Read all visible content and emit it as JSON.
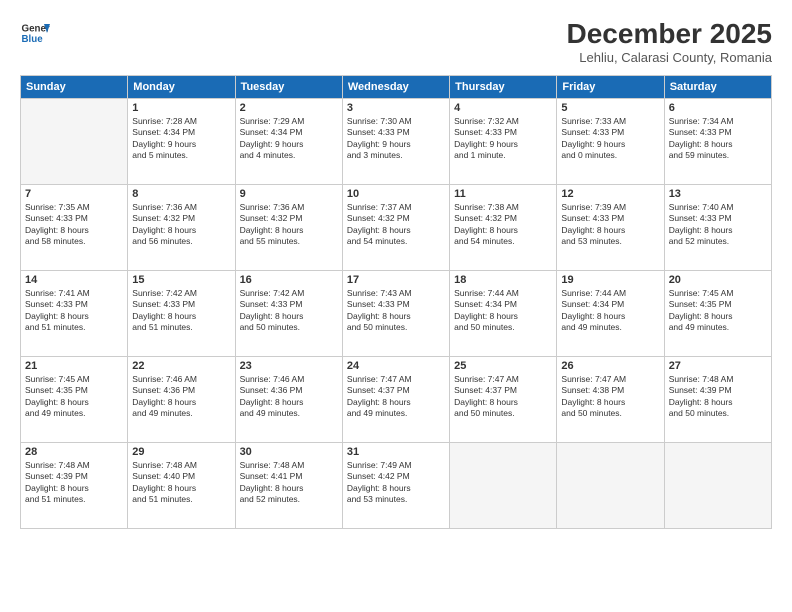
{
  "header": {
    "logo_general": "General",
    "logo_blue": "Blue",
    "month_title": "December 2025",
    "location": "Lehliu, Calarasi County, Romania"
  },
  "weekdays": [
    "Sunday",
    "Monday",
    "Tuesday",
    "Wednesday",
    "Thursday",
    "Friday",
    "Saturday"
  ],
  "weeks": [
    [
      {
        "day": "",
        "info": ""
      },
      {
        "day": "1",
        "info": "Sunrise: 7:28 AM\nSunset: 4:34 PM\nDaylight: 9 hours\nand 5 minutes."
      },
      {
        "day": "2",
        "info": "Sunrise: 7:29 AM\nSunset: 4:34 PM\nDaylight: 9 hours\nand 4 minutes."
      },
      {
        "day": "3",
        "info": "Sunrise: 7:30 AM\nSunset: 4:33 PM\nDaylight: 9 hours\nand 3 minutes."
      },
      {
        "day": "4",
        "info": "Sunrise: 7:32 AM\nSunset: 4:33 PM\nDaylight: 9 hours\nand 1 minute."
      },
      {
        "day": "5",
        "info": "Sunrise: 7:33 AM\nSunset: 4:33 PM\nDaylight: 9 hours\nand 0 minutes."
      },
      {
        "day": "6",
        "info": "Sunrise: 7:34 AM\nSunset: 4:33 PM\nDaylight: 8 hours\nand 59 minutes."
      }
    ],
    [
      {
        "day": "7",
        "info": "Sunrise: 7:35 AM\nSunset: 4:33 PM\nDaylight: 8 hours\nand 58 minutes."
      },
      {
        "day": "8",
        "info": "Sunrise: 7:36 AM\nSunset: 4:32 PM\nDaylight: 8 hours\nand 56 minutes."
      },
      {
        "day": "9",
        "info": "Sunrise: 7:36 AM\nSunset: 4:32 PM\nDaylight: 8 hours\nand 55 minutes."
      },
      {
        "day": "10",
        "info": "Sunrise: 7:37 AM\nSunset: 4:32 PM\nDaylight: 8 hours\nand 54 minutes."
      },
      {
        "day": "11",
        "info": "Sunrise: 7:38 AM\nSunset: 4:32 PM\nDaylight: 8 hours\nand 54 minutes."
      },
      {
        "day": "12",
        "info": "Sunrise: 7:39 AM\nSunset: 4:33 PM\nDaylight: 8 hours\nand 53 minutes."
      },
      {
        "day": "13",
        "info": "Sunrise: 7:40 AM\nSunset: 4:33 PM\nDaylight: 8 hours\nand 52 minutes."
      }
    ],
    [
      {
        "day": "14",
        "info": "Sunrise: 7:41 AM\nSunset: 4:33 PM\nDaylight: 8 hours\nand 51 minutes."
      },
      {
        "day": "15",
        "info": "Sunrise: 7:42 AM\nSunset: 4:33 PM\nDaylight: 8 hours\nand 51 minutes."
      },
      {
        "day": "16",
        "info": "Sunrise: 7:42 AM\nSunset: 4:33 PM\nDaylight: 8 hours\nand 50 minutes."
      },
      {
        "day": "17",
        "info": "Sunrise: 7:43 AM\nSunset: 4:33 PM\nDaylight: 8 hours\nand 50 minutes."
      },
      {
        "day": "18",
        "info": "Sunrise: 7:44 AM\nSunset: 4:34 PM\nDaylight: 8 hours\nand 50 minutes."
      },
      {
        "day": "19",
        "info": "Sunrise: 7:44 AM\nSunset: 4:34 PM\nDaylight: 8 hours\nand 49 minutes."
      },
      {
        "day": "20",
        "info": "Sunrise: 7:45 AM\nSunset: 4:35 PM\nDaylight: 8 hours\nand 49 minutes."
      }
    ],
    [
      {
        "day": "21",
        "info": "Sunrise: 7:45 AM\nSunset: 4:35 PM\nDaylight: 8 hours\nand 49 minutes."
      },
      {
        "day": "22",
        "info": "Sunrise: 7:46 AM\nSunset: 4:36 PM\nDaylight: 8 hours\nand 49 minutes."
      },
      {
        "day": "23",
        "info": "Sunrise: 7:46 AM\nSunset: 4:36 PM\nDaylight: 8 hours\nand 49 minutes."
      },
      {
        "day": "24",
        "info": "Sunrise: 7:47 AM\nSunset: 4:37 PM\nDaylight: 8 hours\nand 49 minutes."
      },
      {
        "day": "25",
        "info": "Sunrise: 7:47 AM\nSunset: 4:37 PM\nDaylight: 8 hours\nand 50 minutes."
      },
      {
        "day": "26",
        "info": "Sunrise: 7:47 AM\nSunset: 4:38 PM\nDaylight: 8 hours\nand 50 minutes."
      },
      {
        "day": "27",
        "info": "Sunrise: 7:48 AM\nSunset: 4:39 PM\nDaylight: 8 hours\nand 50 minutes."
      }
    ],
    [
      {
        "day": "28",
        "info": "Sunrise: 7:48 AM\nSunset: 4:39 PM\nDaylight: 8 hours\nand 51 minutes."
      },
      {
        "day": "29",
        "info": "Sunrise: 7:48 AM\nSunset: 4:40 PM\nDaylight: 8 hours\nand 51 minutes."
      },
      {
        "day": "30",
        "info": "Sunrise: 7:48 AM\nSunset: 4:41 PM\nDaylight: 8 hours\nand 52 minutes."
      },
      {
        "day": "31",
        "info": "Sunrise: 7:49 AM\nSunset: 4:42 PM\nDaylight: 8 hours\nand 53 minutes."
      },
      {
        "day": "",
        "info": ""
      },
      {
        "day": "",
        "info": ""
      },
      {
        "day": "",
        "info": ""
      }
    ]
  ]
}
